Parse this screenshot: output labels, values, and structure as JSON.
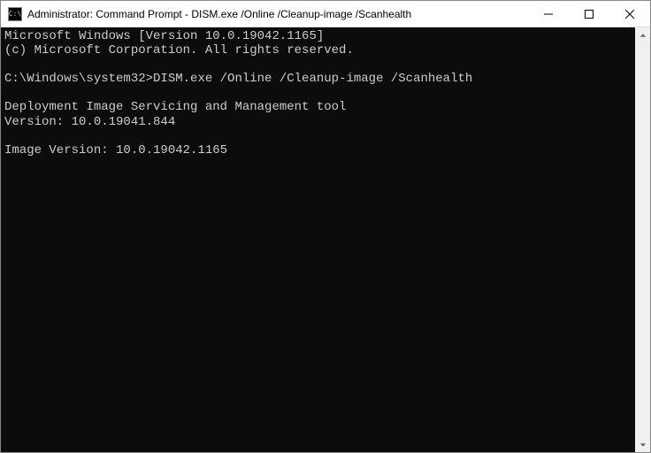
{
  "titlebar": {
    "icon_text": "C:\\",
    "title": "Administrator: Command Prompt - DISM.exe  /Online /Cleanup-image /Scanhealth"
  },
  "terminal": {
    "line1": "Microsoft Windows [Version 10.0.19042.1165]",
    "line2": "(c) Microsoft Corporation. All rights reserved.",
    "blank1": "",
    "prompt": "C:\\Windows\\system32>",
    "command": "DISM.exe /Online /Cleanup-image /Scanhealth",
    "blank2": "",
    "out1": "Deployment Image Servicing and Management tool",
    "out2": "Version: 10.0.19041.844",
    "blank3": "",
    "out3": "Image Version: 10.0.19042.1165"
  }
}
